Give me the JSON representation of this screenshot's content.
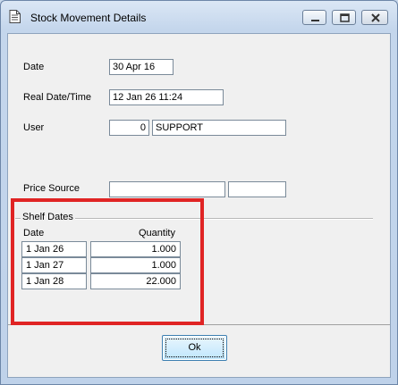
{
  "window": {
    "title": "Stock Movement Details",
    "controls": {
      "minimize": "minimize",
      "maximize": "maximize",
      "close": "close"
    }
  },
  "fields": {
    "date": {
      "label": "Date",
      "value": "30 Apr 16"
    },
    "real_datetime": {
      "label": "Real Date/Time",
      "value": "12 Jan 26 11:24"
    },
    "user": {
      "label": "User",
      "id": "0",
      "name": "SUPPORT"
    },
    "price_source": {
      "label": "Price Source",
      "value1": "",
      "value2": ""
    }
  },
  "shelf_dates": {
    "title": "Shelf Dates",
    "columns": {
      "date": "Date",
      "quantity": "Quantity"
    },
    "rows": [
      {
        "date": "1 Jan 26",
        "quantity": "1.000"
      },
      {
        "date": "1 Jan 27",
        "quantity": "1.000"
      },
      {
        "date": "1 Jan 28",
        "quantity": "22.000"
      }
    ]
  },
  "buttons": {
    "ok": "Ok"
  },
  "colors": {
    "highlight": "#e02424",
    "accent": "#3c7fb1"
  }
}
